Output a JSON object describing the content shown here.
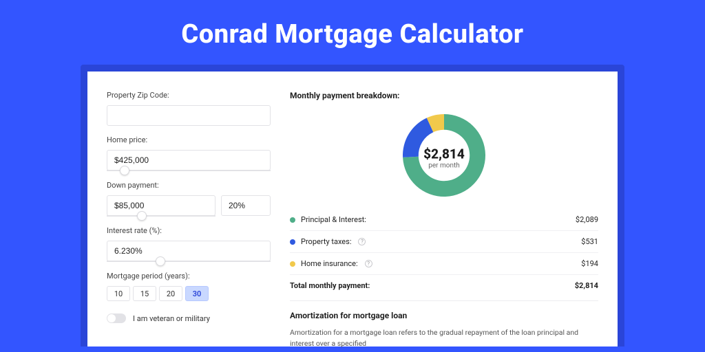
{
  "title": "Conrad Mortgage Calculator",
  "form": {
    "zip_label": "Property Zip Code:",
    "zip_value": "",
    "home_price_label": "Home price:",
    "home_price_value": "$425,000",
    "down_payment_label": "Down payment:",
    "down_payment_value": "$85,000",
    "down_payment_pct": "20%",
    "interest_label": "Interest rate (%):",
    "interest_value": "6.230%",
    "period_label": "Mortgage period (years):",
    "periods": {
      "p10": "10",
      "p15": "15",
      "p20": "20",
      "p30": "30"
    },
    "veteran_label": "I am veteran or military"
  },
  "breakdown": {
    "title": "Monthly payment breakdown:",
    "center_amount": "$2,814",
    "center_sub": "per month",
    "pi_label": "Principal & Interest:",
    "pi_value": "$2,089",
    "tax_label": "Property taxes:",
    "tax_value": "$531",
    "ins_label": "Home insurance:",
    "ins_value": "$194",
    "total_label": "Total monthly payment:",
    "total_value": "$2,814"
  },
  "amort": {
    "title": "Amortization for mortgage loan",
    "text": "Amortization for a mortgage loan refers to the gradual repayment of the loan principal and interest over a specified"
  },
  "colors": {
    "pi": "#4fae89",
    "tax": "#2f5ae0",
    "ins": "#f1c94b"
  },
  "chart_data": {
    "type": "pie",
    "title": "Monthly payment breakdown",
    "series": [
      {
        "name": "Principal & Interest",
        "value": 2089,
        "color": "#4fae89"
      },
      {
        "name": "Property taxes",
        "value": 531,
        "color": "#2f5ae0"
      },
      {
        "name": "Home insurance",
        "value": 194,
        "color": "#f1c94b"
      }
    ],
    "total": 2814,
    "center_label": "$2,814 per month",
    "donut_inner_ratio": 0.62
  }
}
